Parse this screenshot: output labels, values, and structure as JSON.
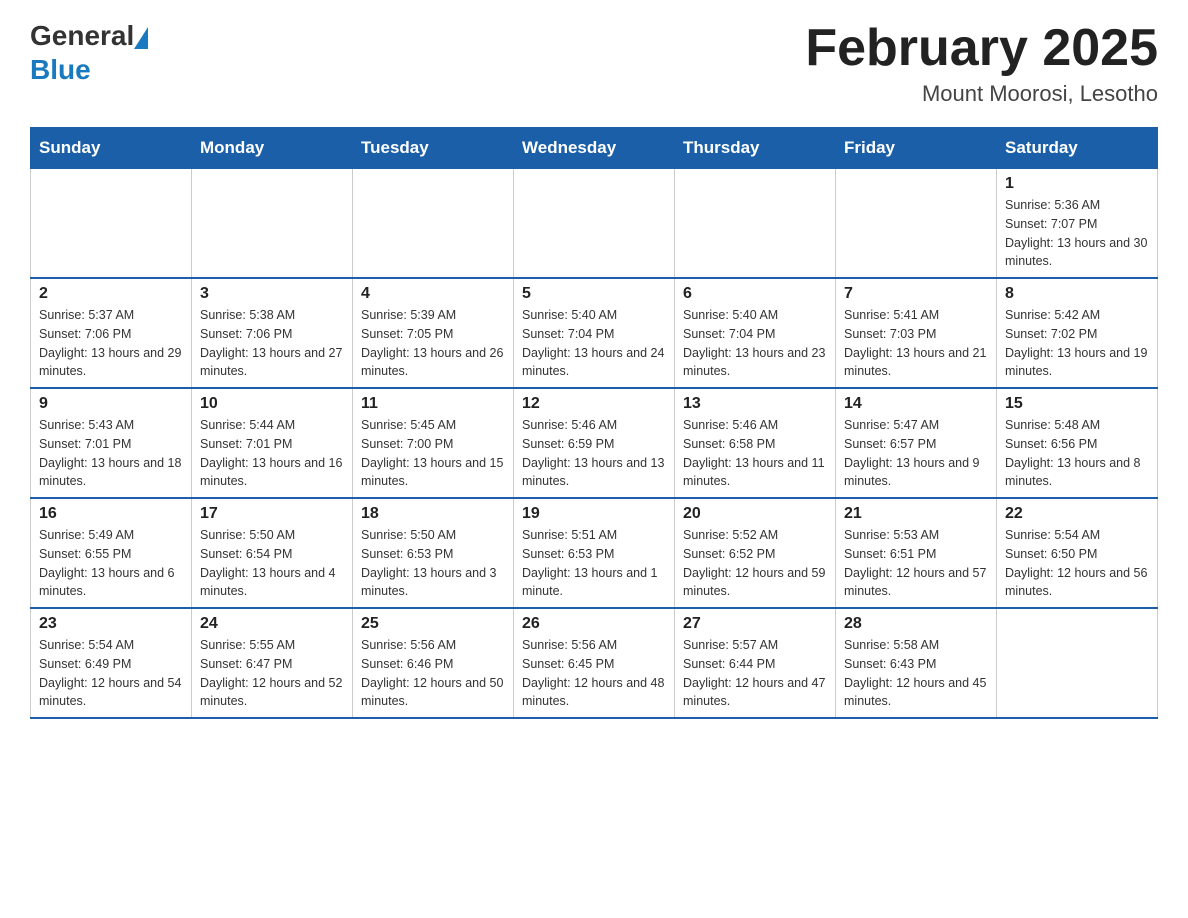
{
  "header": {
    "logo": {
      "general": "General",
      "blue": "Blue"
    },
    "title": "February 2025",
    "location": "Mount Moorosi, Lesotho"
  },
  "days_of_week": [
    "Sunday",
    "Monday",
    "Tuesday",
    "Wednesday",
    "Thursday",
    "Friday",
    "Saturday"
  ],
  "weeks": [
    [
      {
        "day": "",
        "info": ""
      },
      {
        "day": "",
        "info": ""
      },
      {
        "day": "",
        "info": ""
      },
      {
        "day": "",
        "info": ""
      },
      {
        "day": "",
        "info": ""
      },
      {
        "day": "",
        "info": ""
      },
      {
        "day": "1",
        "info": "Sunrise: 5:36 AM\nSunset: 7:07 PM\nDaylight: 13 hours and 30 minutes."
      }
    ],
    [
      {
        "day": "2",
        "info": "Sunrise: 5:37 AM\nSunset: 7:06 PM\nDaylight: 13 hours and 29 minutes."
      },
      {
        "day": "3",
        "info": "Sunrise: 5:38 AM\nSunset: 7:06 PM\nDaylight: 13 hours and 27 minutes."
      },
      {
        "day": "4",
        "info": "Sunrise: 5:39 AM\nSunset: 7:05 PM\nDaylight: 13 hours and 26 minutes."
      },
      {
        "day": "5",
        "info": "Sunrise: 5:40 AM\nSunset: 7:04 PM\nDaylight: 13 hours and 24 minutes."
      },
      {
        "day": "6",
        "info": "Sunrise: 5:40 AM\nSunset: 7:04 PM\nDaylight: 13 hours and 23 minutes."
      },
      {
        "day": "7",
        "info": "Sunrise: 5:41 AM\nSunset: 7:03 PM\nDaylight: 13 hours and 21 minutes."
      },
      {
        "day": "8",
        "info": "Sunrise: 5:42 AM\nSunset: 7:02 PM\nDaylight: 13 hours and 19 minutes."
      }
    ],
    [
      {
        "day": "9",
        "info": "Sunrise: 5:43 AM\nSunset: 7:01 PM\nDaylight: 13 hours and 18 minutes."
      },
      {
        "day": "10",
        "info": "Sunrise: 5:44 AM\nSunset: 7:01 PM\nDaylight: 13 hours and 16 minutes."
      },
      {
        "day": "11",
        "info": "Sunrise: 5:45 AM\nSunset: 7:00 PM\nDaylight: 13 hours and 15 minutes."
      },
      {
        "day": "12",
        "info": "Sunrise: 5:46 AM\nSunset: 6:59 PM\nDaylight: 13 hours and 13 minutes."
      },
      {
        "day": "13",
        "info": "Sunrise: 5:46 AM\nSunset: 6:58 PM\nDaylight: 13 hours and 11 minutes."
      },
      {
        "day": "14",
        "info": "Sunrise: 5:47 AM\nSunset: 6:57 PM\nDaylight: 13 hours and 9 minutes."
      },
      {
        "day": "15",
        "info": "Sunrise: 5:48 AM\nSunset: 6:56 PM\nDaylight: 13 hours and 8 minutes."
      }
    ],
    [
      {
        "day": "16",
        "info": "Sunrise: 5:49 AM\nSunset: 6:55 PM\nDaylight: 13 hours and 6 minutes."
      },
      {
        "day": "17",
        "info": "Sunrise: 5:50 AM\nSunset: 6:54 PM\nDaylight: 13 hours and 4 minutes."
      },
      {
        "day": "18",
        "info": "Sunrise: 5:50 AM\nSunset: 6:53 PM\nDaylight: 13 hours and 3 minutes."
      },
      {
        "day": "19",
        "info": "Sunrise: 5:51 AM\nSunset: 6:53 PM\nDaylight: 13 hours and 1 minute."
      },
      {
        "day": "20",
        "info": "Sunrise: 5:52 AM\nSunset: 6:52 PM\nDaylight: 12 hours and 59 minutes."
      },
      {
        "day": "21",
        "info": "Sunrise: 5:53 AM\nSunset: 6:51 PM\nDaylight: 12 hours and 57 minutes."
      },
      {
        "day": "22",
        "info": "Sunrise: 5:54 AM\nSunset: 6:50 PM\nDaylight: 12 hours and 56 minutes."
      }
    ],
    [
      {
        "day": "23",
        "info": "Sunrise: 5:54 AM\nSunset: 6:49 PM\nDaylight: 12 hours and 54 minutes."
      },
      {
        "day": "24",
        "info": "Sunrise: 5:55 AM\nSunset: 6:47 PM\nDaylight: 12 hours and 52 minutes."
      },
      {
        "day": "25",
        "info": "Sunrise: 5:56 AM\nSunset: 6:46 PM\nDaylight: 12 hours and 50 minutes."
      },
      {
        "day": "26",
        "info": "Sunrise: 5:56 AM\nSunset: 6:45 PM\nDaylight: 12 hours and 48 minutes."
      },
      {
        "day": "27",
        "info": "Sunrise: 5:57 AM\nSunset: 6:44 PM\nDaylight: 12 hours and 47 minutes."
      },
      {
        "day": "28",
        "info": "Sunrise: 5:58 AM\nSunset: 6:43 PM\nDaylight: 12 hours and 45 minutes."
      },
      {
        "day": "",
        "info": ""
      }
    ]
  ]
}
